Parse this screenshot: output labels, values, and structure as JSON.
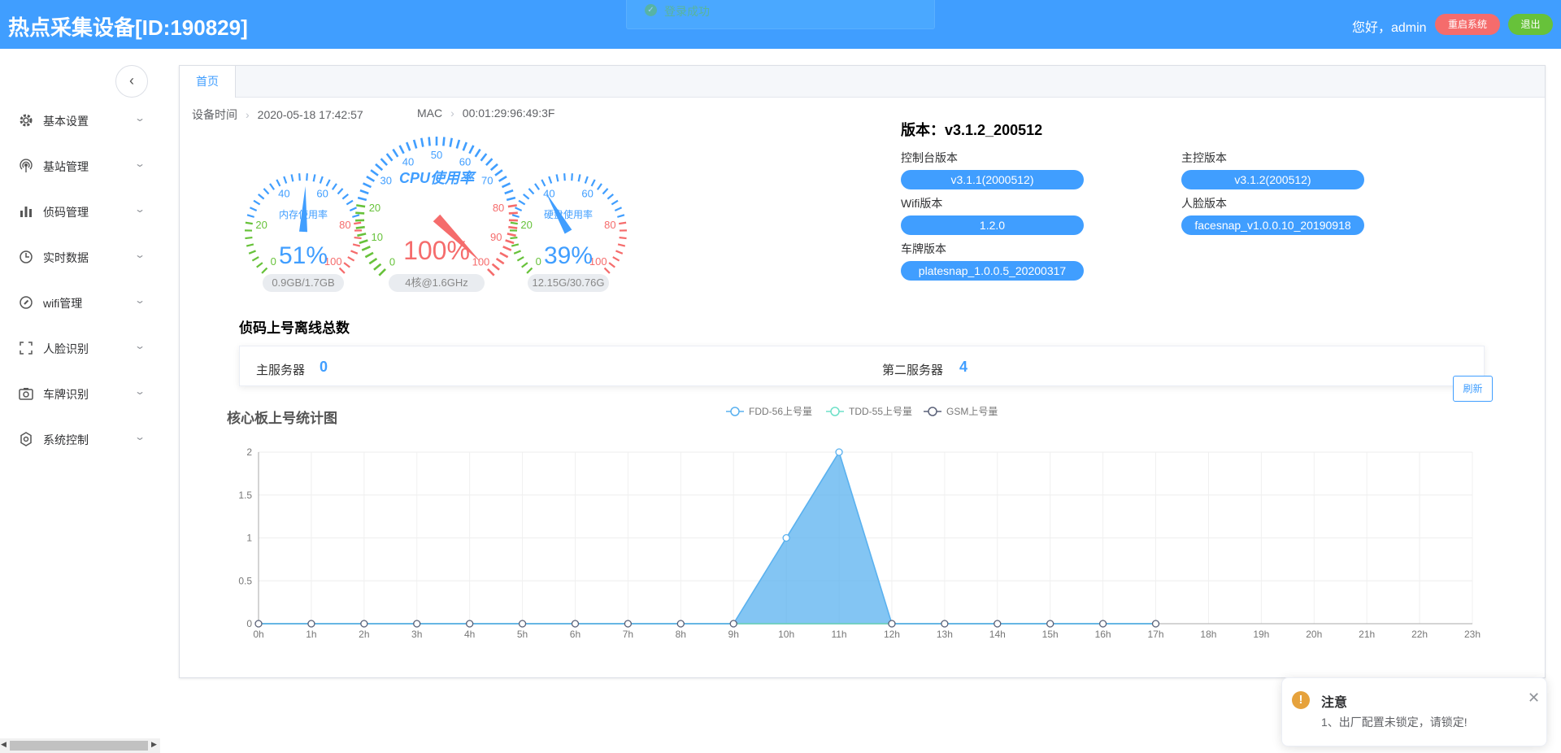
{
  "header": {
    "title": "热点采集设备[ID:190829]",
    "greeting": "您好，admin",
    "restart_label": "重启系统",
    "logout_label": "退出",
    "toast": "登录成功"
  },
  "sidebar": {
    "items": [
      {
        "label": "基本设置",
        "icon": "gear-icon"
      },
      {
        "label": "基站管理",
        "icon": "antenna-icon"
      },
      {
        "label": "侦码管理",
        "icon": "bar-chart-icon"
      },
      {
        "label": "实时数据",
        "icon": "clock-icon"
      },
      {
        "label": "wifi管理",
        "icon": "compass-icon"
      },
      {
        "label": "人脸识别",
        "icon": "scan-frame-icon"
      },
      {
        "label": "车牌识别",
        "icon": "camera-icon"
      },
      {
        "label": "系统控制",
        "icon": "settings-icon"
      }
    ]
  },
  "tabs": [
    {
      "label": "首页"
    }
  ],
  "device": {
    "time_label": "设备时间",
    "time_value": "2020-05-18 17:42:57",
    "mac_label": "MAC",
    "mac_value": "00:01:29:96:49:3F"
  },
  "gauges": {
    "memory": {
      "title": "内存使用率",
      "percent": 51,
      "value_text": "51%",
      "detail": "0.9GB/1.7GB",
      "ticks": [
        "0",
        "20",
        "40",
        "60",
        "80",
        "100"
      ]
    },
    "cpu": {
      "title": "CPU使用率",
      "percent": 100,
      "value_text": "100%",
      "detail": "4核@1.6GHz",
      "ticks": [
        "0",
        "10",
        "20",
        "30",
        "40",
        "50",
        "60",
        "70",
        "80",
        "90",
        "100"
      ]
    },
    "disk": {
      "title": "硬盘使用率",
      "percent": 39,
      "value_text": "39%",
      "detail": "12.15G/30.76G",
      "ticks": [
        "0",
        "20",
        "40",
        "60",
        "80",
        "100"
      ]
    }
  },
  "versions": {
    "title": "版本：v3.1.2_200512",
    "console_label": "控制台版本",
    "console_value": "v3.1.1(2000512)",
    "master_label": "主控版本",
    "master_value": "v3.1.2(200512)",
    "wifi_label": "Wifi版本",
    "wifi_value": "1.2.0",
    "face_label": "人脸版本",
    "face_value": "facesnap_v1.0.0.10_20190918",
    "plate_label": "车牌版本",
    "plate_value": "platesnap_1.0.0.5_20200317"
  },
  "offline": {
    "title": "侦码上号离线总数",
    "primary_label": "主服务器",
    "primary_value": "0",
    "secondary_label": "第二服务器",
    "secondary_value": "4",
    "refresh_label": "刷新"
  },
  "chart_data": {
    "type": "area",
    "title": "核心板上号统计图",
    "x": [
      "0h",
      "1h",
      "2h",
      "3h",
      "4h",
      "5h",
      "6h",
      "7h",
      "8h",
      "9h",
      "10h",
      "11h",
      "12h",
      "13h",
      "14h",
      "15h",
      "16h",
      "17h",
      "18h",
      "19h",
      "20h",
      "21h",
      "22h",
      "23h"
    ],
    "series": [
      {
        "name": "FDD-56上号量",
        "values": [
          0,
          0,
          0,
          0,
          0,
          0,
          0,
          0,
          0,
          0,
          1,
          2,
          0,
          0,
          0,
          0,
          0,
          0
        ]
      },
      {
        "name": "TDD-55上号量",
        "values": [
          0,
          0,
          0,
          0,
          0,
          0,
          0,
          0,
          0,
          0,
          0,
          0,
          0,
          0,
          0,
          0,
          0,
          0
        ]
      },
      {
        "name": "GSM上号量",
        "values": [
          0,
          0,
          0,
          0,
          0,
          0,
          0,
          0,
          0,
          0,
          0,
          0,
          0,
          0,
          0,
          0,
          0,
          0
        ]
      }
    ],
    "ylim": [
      0,
      2
    ],
    "yticks": [
      "0",
      "0.5",
      "1",
      "1.5",
      "2"
    ],
    "grid": true,
    "legend": "top-center",
    "colors": [
      "#5ab1ef",
      "#6ee0c8",
      "#5a6178"
    ]
  },
  "notification": {
    "title": "注意",
    "text": "1、出厂配置未锁定，请锁定!"
  },
  "colors": {
    "primary": "#409eff",
    "danger": "#f56c6c",
    "success": "#67c23a",
    "warning": "#e6a23c"
  }
}
